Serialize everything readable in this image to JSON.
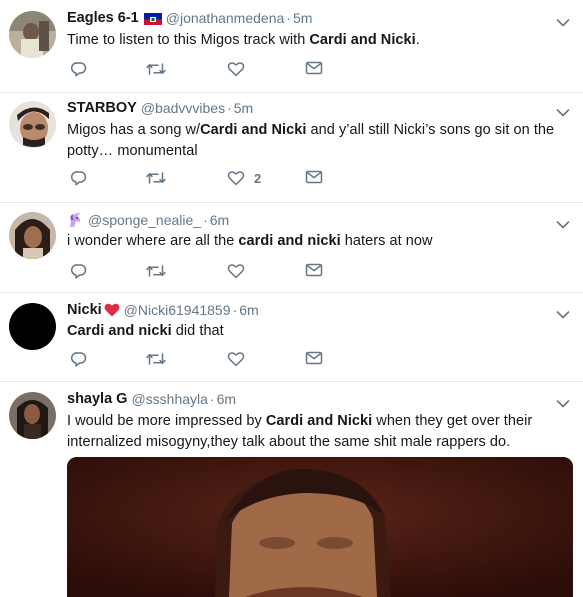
{
  "tweets": [
    {
      "name": "Eagles 6-1",
      "flag": "haiti-flag",
      "handle": "@jonathanmedena",
      "time": "5m",
      "text_parts": [
        "Time to listen to this Migos track with ",
        "Cardi and Nicki",
        "."
      ],
      "likes": ""
    },
    {
      "name": "STARBOY",
      "handle": "@badvvvibes",
      "time": "5m",
      "text_parts": [
        "Migos has a song w/",
        "Cardi and Nicki",
        " and y’all still Nicki’s sons go sit on the potty… monumental"
      ],
      "likes": "2"
    },
    {
      "name": "",
      "name_emoji": "unicorn-icon",
      "handle": "@sponge_nealie_",
      "time": "6m",
      "text_parts": [
        "i wonder where are all the ",
        "cardi and nicki",
        " haters at now"
      ],
      "likes": ""
    },
    {
      "name": "Nicki",
      "name_emoji": "red-heart-icon",
      "handle": "@Nicki61941859",
      "time": "6m",
      "text_parts": [
        "",
        "Cardi and nicki",
        " did that"
      ],
      "likes": ""
    },
    {
      "name": "shayla G",
      "handle": "@ssshhayla",
      "time": "6m",
      "text_parts": [
        "I would be more impressed by ",
        "Cardi and Nicki",
        " when they get over their internalized misogyny,they talk about the same shit male rappers do."
      ],
      "likes": ""
    }
  ],
  "separator": "·",
  "icons": {
    "reply": "reply-icon",
    "retweet": "retweet-icon",
    "like": "heart-icon",
    "dm": "envelope-icon",
    "menu": "chevron-down-icon"
  },
  "colors": {
    "text": "#14171a",
    "secondary": "#657786",
    "border": "#e6ecf0",
    "heart": "#e0245e"
  }
}
